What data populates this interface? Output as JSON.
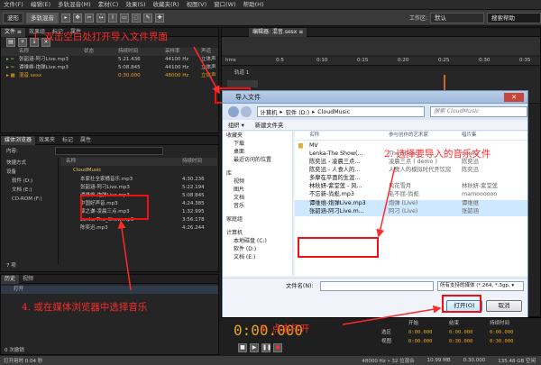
{
  "menu": [
    "文件(F)",
    "编辑(E)",
    "多轨混音(M)",
    "素材(C)",
    "效果(S)",
    "收藏夹(R)",
    "视图(V)",
    "窗口(W)",
    "帮助(H)"
  ],
  "toolbar": {
    "waveform": "波形",
    "multitrack": "多轨混音",
    "workspace": "工作区:",
    "workspace_value": "默认",
    "search": "搜索帮助"
  },
  "files_panel": {
    "tabs": [
      "文件 ≡",
      "效果组",
      "标记",
      "属性"
    ],
    "columns": [
      "名称",
      "状态",
      "持续时间",
      "采样率",
      "声道"
    ],
    "rows": [
      {
        "name": "张韶涵-阿刁Live.mp3",
        "duration": "5:21.436",
        "rate": "44100 Hz",
        "ch": "立体声"
      },
      {
        "name": "谭维维-炮弹Live.mp3",
        "duration": "5:08.845",
        "rate": "44100 Hz",
        "ch": "立体声"
      },
      {
        "name": "混音.sesx",
        "duration": "0:30.000",
        "rate": "48000 Hz",
        "ch": "立体声"
      }
    ]
  },
  "media_browser": {
    "tabs": [
      "媒体浏览器",
      "效果夹",
      "标记",
      "属性"
    ],
    "content_label": "内容:",
    "col_name": "名称",
    "col_duration": "持续时间",
    "tree": [
      "快捷方式",
      "设备",
      "软件 (D:)",
      "文档 (E:)",
      "CD-ROM (F:)"
    ],
    "folder": "CloudMusic",
    "files": [
      {
        "name": "本家社全家桶音乐.mp3",
        "duration": "4:30.236"
      },
      {
        "name": "张韶涵-阿刁Live.mp3",
        "duration": "5:22.194"
      },
      {
        "name": "谭维维-炮弹Live.mp3",
        "duration": "5:08.845"
      },
      {
        "name": "中国好声音.mp3",
        "duration": "4:24.385"
      },
      {
        "name": "薛之谦-凌晨三点.mp3",
        "duration": "1:32.995"
      },
      {
        "name": "Lenka-The_Show.mp3",
        "duration": "3:56.178"
      },
      {
        "name": "陈奕迅.mp3",
        "duration": "4:26.244"
      }
    ],
    "count": "7 项"
  },
  "history": {
    "tabs": [
      "历史",
      "视频"
    ],
    "item": "打开",
    "undo": "0 次撤销"
  },
  "editor": {
    "tab": "编辑器: 混音.sesx ≡",
    "track": "轨道 1",
    "ruler": [
      "hms",
      "0:5",
      "0:10",
      "0:15",
      "0:20",
      "0:25",
      "0:30",
      "0:35"
    ]
  },
  "dialog": {
    "title": "导入文件",
    "breadcrumb": [
      "计算机",
      "软件 (D:)",
      "CloudMusic"
    ],
    "search": "搜索 CloudMusic",
    "organize": "组织 ▾",
    "new_folder": "新建文件夹",
    "nav": [
      "收藏夹",
      "下载",
      "桌面",
      "最近访问的位置",
      "库",
      "视频",
      "图片",
      "文档",
      "音乐",
      "家庭组",
      "计算机",
      "本地磁盘 (C:)",
      "软件 (D:)",
      "文档 (E:)"
    ],
    "col_name": "名称",
    "col_artist": "参与创作的艺术家",
    "col_album": "唱片集",
    "files": [
      {
        "name": "MV",
        "artist": "",
        "album": ""
      },
      {
        "name": "Lenka-The Show(...",
        "artist": "The Show",
        "album": "Lenka"
      },
      {
        "name": "陈奕迅 - 凌晨三点...",
        "artist": "凌晨三点 ( demo )",
        "album": "陈奕迅"
      },
      {
        "name": "陈奕迅 - 人食人的...",
        "artist": "人食人的模拟时代开饮房",
        "album": "陈奕迅"
      },
      {
        "name": "多摩在平面的生涯...",
        "artist": "",
        "album": ""
      },
      {
        "name": "林秋妍-紫堂莲 - 风...",
        "artist": "风花雪月",
        "album": "林秋妍-紫堂莲"
      },
      {
        "name": "不忘新-尚彪.mp3",
        "artist": "毛不屈-尚彪",
        "album": "mamoooooo"
      },
      {
        "name": "谭维维-炮弹Live.mp3",
        "artist": "炮弹 (Live)",
        "album": "谭维维"
      },
      {
        "name": "张韶涵-阿刁Live.m...",
        "artist": "阿刁 (Live)",
        "album": "张韶涵"
      }
    ],
    "filename_label": "文件名(N):",
    "filetype": "所有支持的媒体 (*.264, *.3gp, ▾",
    "open": "打开(O)",
    "cancel": "取消"
  },
  "annotations": {
    "a1": "1. 双击空白处打开导入文件界面",
    "a2": "2. 选择要导入的音乐文件",
    "a3": "3. 点击打开",
    "a4": "4. 或在媒体浏览器中选择音乐"
  },
  "transport_timer": "0:00.000",
  "selection": {
    "labels": [
      "开始",
      "结束",
      "持续时间"
    ],
    "rows": [
      "选区",
      "视图"
    ],
    "val": "0:00.000",
    "end": "0:30.000"
  },
  "status": {
    "left": "打开用时 0.04 秒",
    "rate": "48000 Hz • 32 位混合",
    "size": "10.99 MB",
    "dur": "0:30.000",
    "free": "135.48 GB 空闲"
  },
  "colors": {
    "annot": "#ff2a2a",
    "accent": "#e8a321"
  }
}
